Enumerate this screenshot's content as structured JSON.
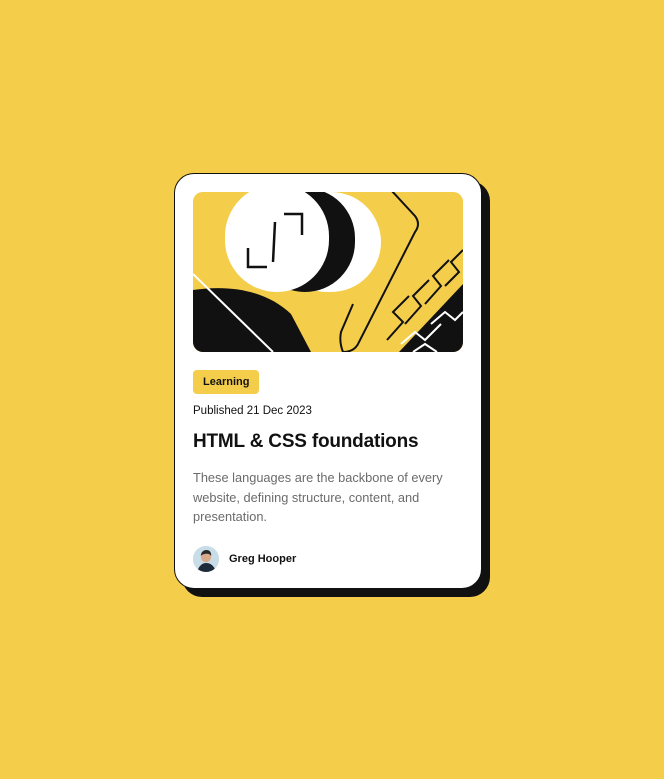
{
  "card": {
    "tag": "Learning",
    "published": "Published 21 Dec 2023",
    "title": "HTML & CSS foundations",
    "description": "These languages are the backbone of every website, defining structure, content, and presentation.",
    "author": "Greg Hooper"
  },
  "colors": {
    "background": "#F4CE4B",
    "ink": "#111111",
    "muted_text": "#6b6b6b",
    "card": "#ffffff"
  },
  "icons": {
    "hero": "blog-illustration",
    "avatar": "author-avatar"
  }
}
